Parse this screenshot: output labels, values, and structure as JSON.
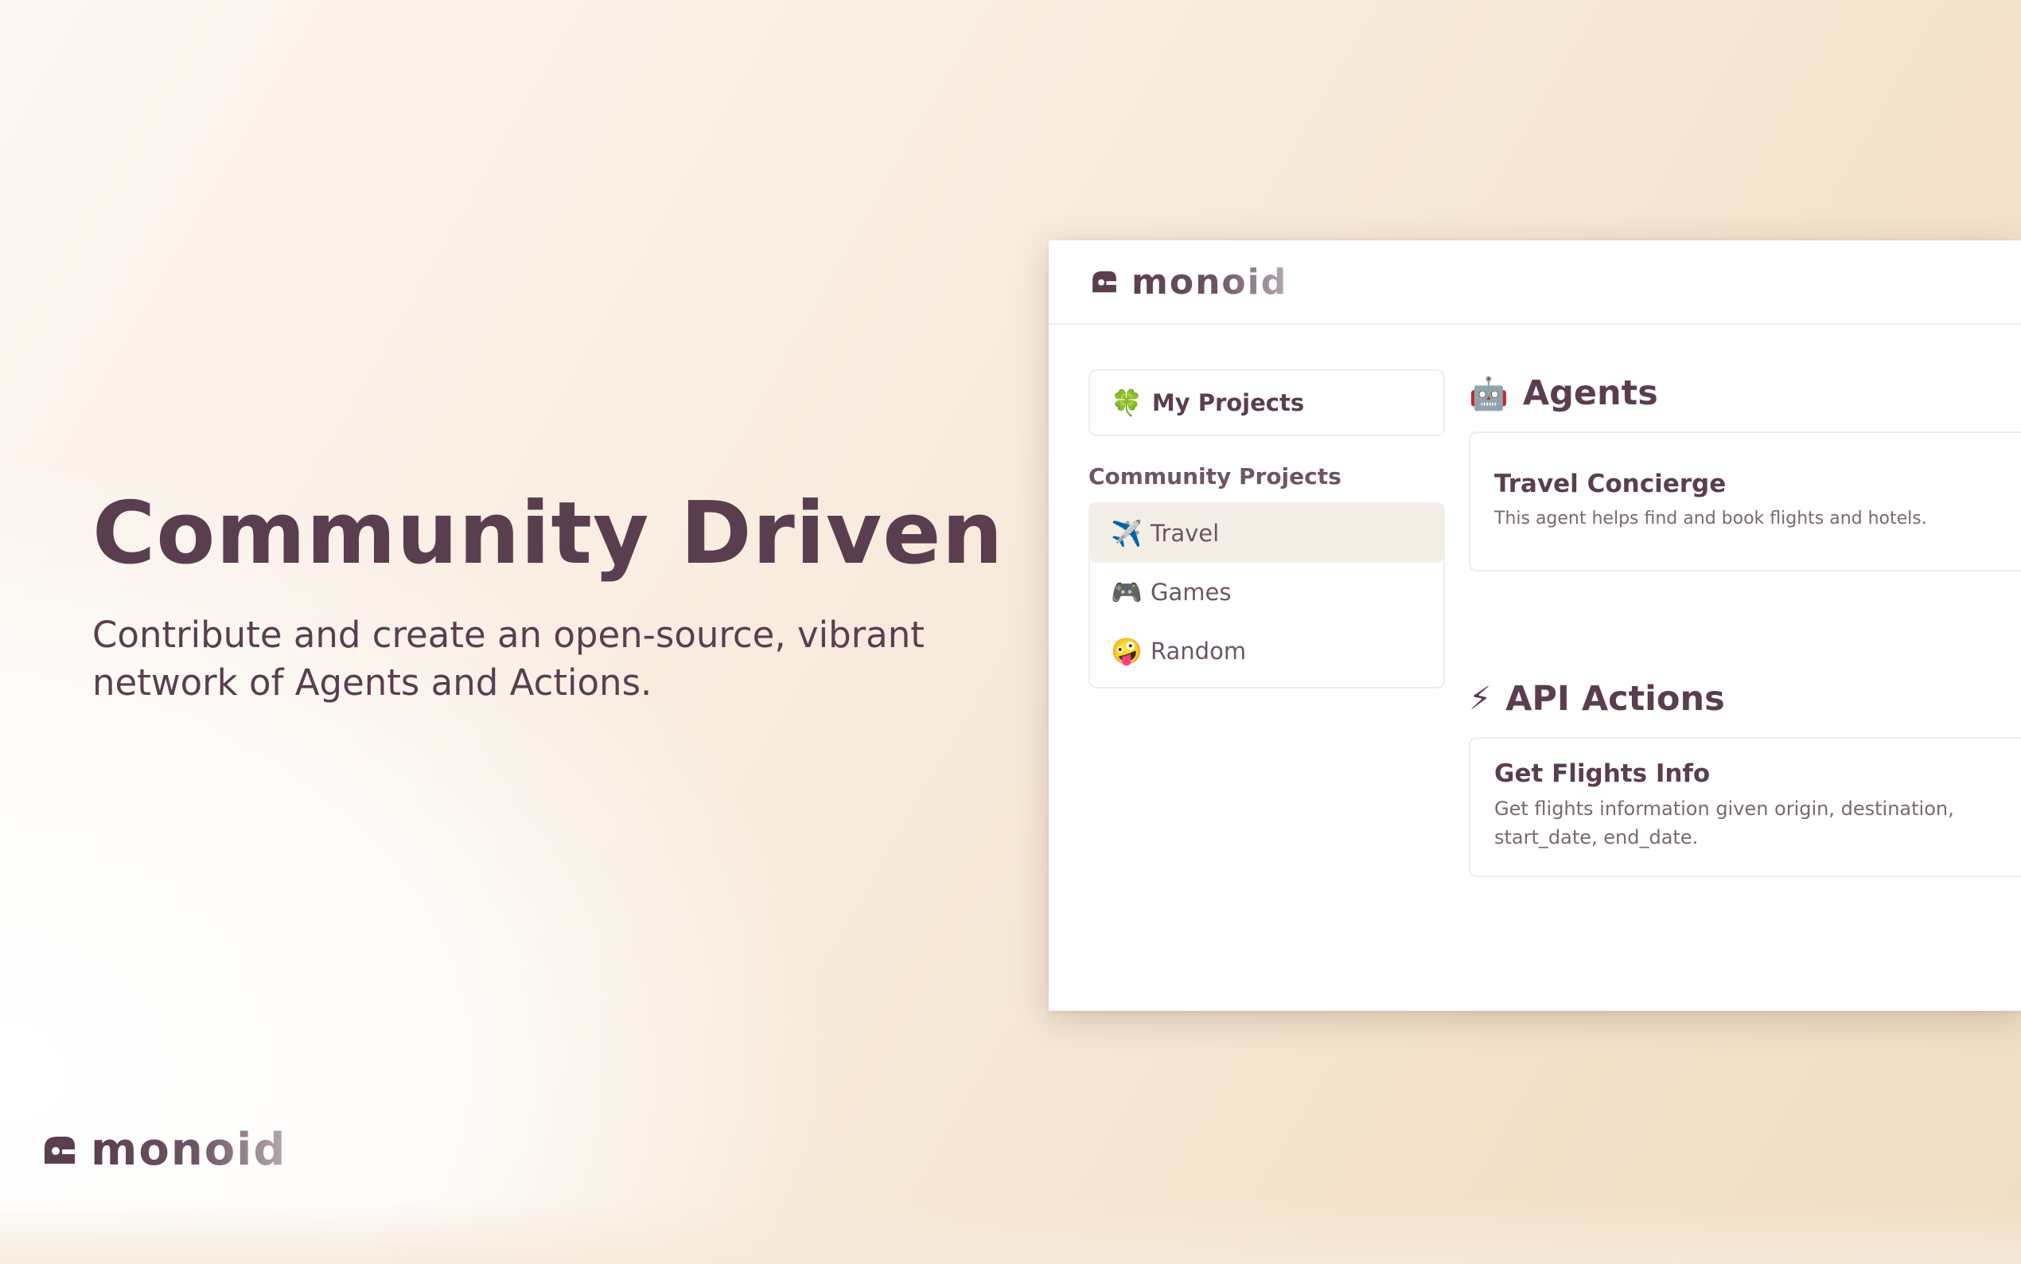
{
  "hero": {
    "title": "Community Driven",
    "subtitle": "Contribute and create an open-source, vibrant network of Agents and Actions."
  },
  "brand": {
    "name": "monoid",
    "color": "#5a3e50"
  },
  "app": {
    "sidebar": {
      "my_projects": {
        "icon": "clover-emoji",
        "emoji": "🍀",
        "label": "My Projects"
      },
      "community_label": "Community Projects",
      "community_items": [
        {
          "icon": "airplane-emoji",
          "emoji": "✈️",
          "label": "Travel",
          "active": true
        },
        {
          "icon": "game-controller-emoji",
          "emoji": "🎮",
          "label": "Games",
          "active": false
        },
        {
          "icon": "zany-face-emoji",
          "emoji": "🤪",
          "label": "Random",
          "active": false
        }
      ]
    },
    "agents": {
      "icon": "robot-emoji",
      "emoji": "🤖",
      "title": "Agents",
      "cards": [
        {
          "title": "Travel Concierge",
          "description": "This agent helps find and book flights and hotels."
        }
      ]
    },
    "actions": {
      "icon": "lightning-emoji",
      "emoji": "⚡",
      "title": "API Actions",
      "cards": [
        {
          "title": "Get Flights Info",
          "description": "Get flights information given origin, destination, start_date, end_date."
        }
      ]
    }
  }
}
